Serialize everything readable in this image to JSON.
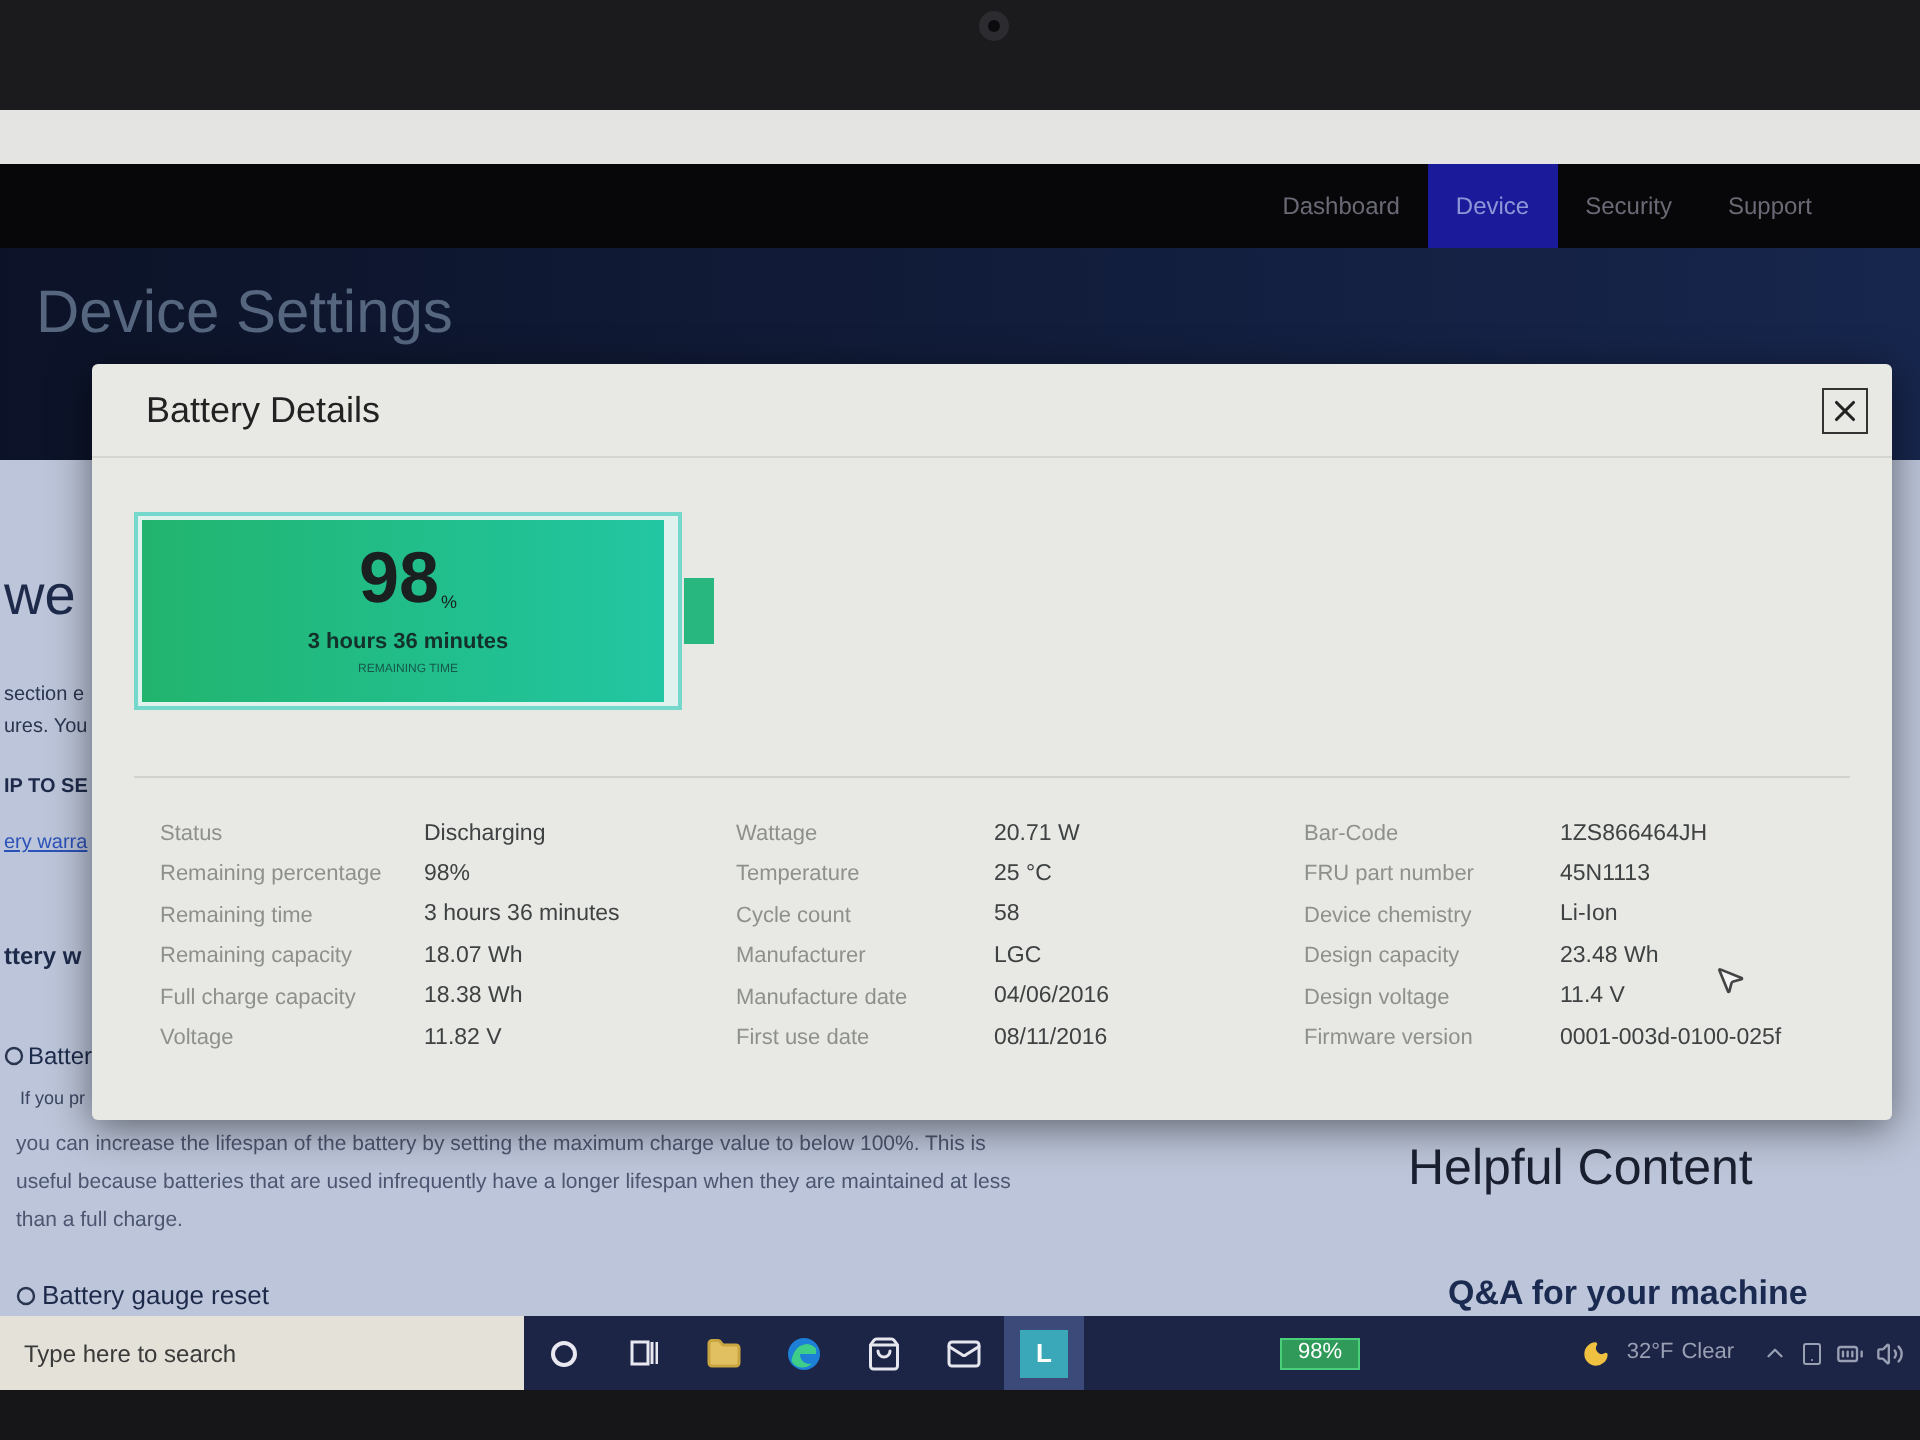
{
  "nav_bar": {
    "items": [
      {
        "label": "Dashboard",
        "selected": false
      },
      {
        "label": "Device",
        "selected": true
      },
      {
        "label": "Security",
        "selected": false
      },
      {
        "label": "Support",
        "selected": false
      }
    ]
  },
  "banner": {
    "title": "Device Settings"
  },
  "page": {
    "heading": "we",
    "intro": [
      "section e",
      "ures. You"
    ],
    "jump_label": "IP TO SE",
    "jump_link": "ery warra",
    "section_title": "ttery w",
    "item_title": "Batter",
    "item_text": "If you pr",
    "paragraph": "you can increase the lifespan of the battery by setting the maximum charge value to below 100%. This is useful because batteries that are used infrequently have a longer lifespan when they are maintained at less than a full charge.",
    "next_item": "Battery gauge reset"
  },
  "sidebar": {
    "title": "Helpful Content",
    "subtitle": "Q&A for your machine"
  },
  "dialog": {
    "title": "Battery Details",
    "battery": {
      "percent": "98",
      "unit": "%",
      "time": "3 hours 36 minutes",
      "caption": "REMAINING TIME",
      "level": 0.98
    },
    "details": [
      [
        {
          "label": "Status",
          "value": "Discharging"
        },
        {
          "label": "Remaining percentage",
          "value": "98%"
        },
        {
          "label": "Remaining time",
          "value": "3 hours 36 minutes"
        },
        {
          "label": "Remaining capacity",
          "value": "18.07 Wh"
        },
        {
          "label": "Full charge capacity",
          "value": "18.38 Wh"
        },
        {
          "label": "Voltage",
          "value": "11.82 V"
        }
      ],
      [
        {
          "label": "Wattage",
          "value": "20.71 W"
        },
        {
          "label": "Temperature",
          "value": "25 °C"
        },
        {
          "label": "Cycle count",
          "value": "58"
        },
        {
          "label": "Manufacturer",
          "value": "LGC"
        },
        {
          "label": "Manufacture date",
          "value": "04/06/2016"
        },
        {
          "label": "First use date",
          "value": "08/11/2016"
        }
      ],
      [
        {
          "label": "Bar-Code",
          "value": "1ZS866464JH"
        },
        {
          "label": "FRU part number",
          "value": "45N1113"
        },
        {
          "label": "Device chemistry",
          "value": "Li-Ion"
        },
        {
          "label": "Design capacity",
          "value": "23.48 Wh"
        },
        {
          "label": "Design voltage",
          "value": "11.4 V"
        },
        {
          "label": "Firmware version",
          "value": "0001-003d-0100-025f"
        }
      ]
    ]
  },
  "taskbar": {
    "search": {
      "placeholder": "Type here to search"
    },
    "pinned_app": {
      "label": "L",
      "selected": true
    },
    "battery": "98%",
    "weather": {
      "temperature": "32°F",
      "condition": "Clear"
    }
  }
}
